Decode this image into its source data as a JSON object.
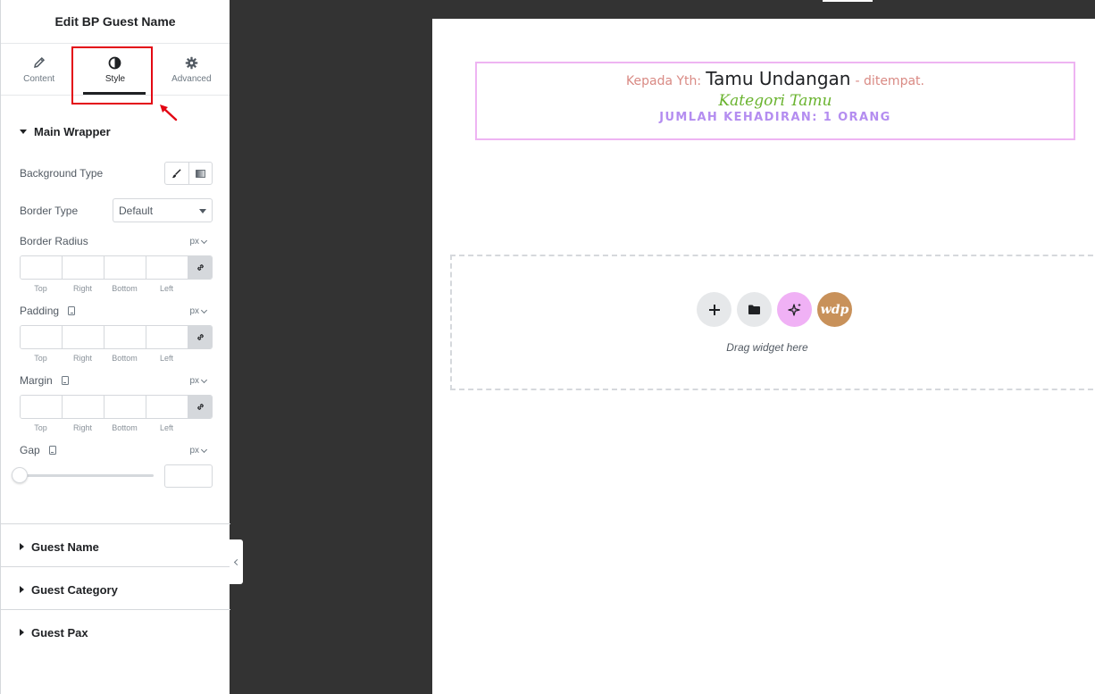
{
  "panel": {
    "title": "Edit BP Guest Name",
    "tabs": [
      {
        "label": "Content",
        "icon": "pencil-icon"
      },
      {
        "label": "Style",
        "icon": "contrast-icon",
        "active": true
      },
      {
        "label": "Advanced",
        "icon": "gear-icon"
      }
    ],
    "main_wrapper": {
      "title": "Main Wrapper",
      "background_type_label": "Background Type",
      "border_type_label": "Border Type",
      "border_type_value": "Default",
      "border_radius_label": "Border Radius",
      "padding_label": "Padding",
      "margin_label": "Margin",
      "gap_label": "Gap",
      "unit": "px",
      "dims": [
        "Top",
        "Right",
        "Bottom",
        "Left"
      ]
    },
    "sections": [
      "Guest Name",
      "Guest Category",
      "Guest Pax"
    ]
  },
  "canvas": {
    "guest": {
      "prefix": "Kepada Yth:",
      "name": "Tamu Undangan",
      "suffix": "- ditempat.",
      "category": "Kategori Tamu",
      "pax": "JUMLAH KEHADIRAN: 1 ORANG"
    },
    "drop_text": "Drag widget here",
    "wdp_label": "wdp"
  },
  "colors": {
    "highlight": "#e30613",
    "guest_border": "#eeb4f2",
    "prefix": "#d98a84",
    "category": "#69b32e",
    "pax": "#b48df0",
    "ai_button": "#f0b1f5",
    "wdp_button": "#c8915a"
  }
}
